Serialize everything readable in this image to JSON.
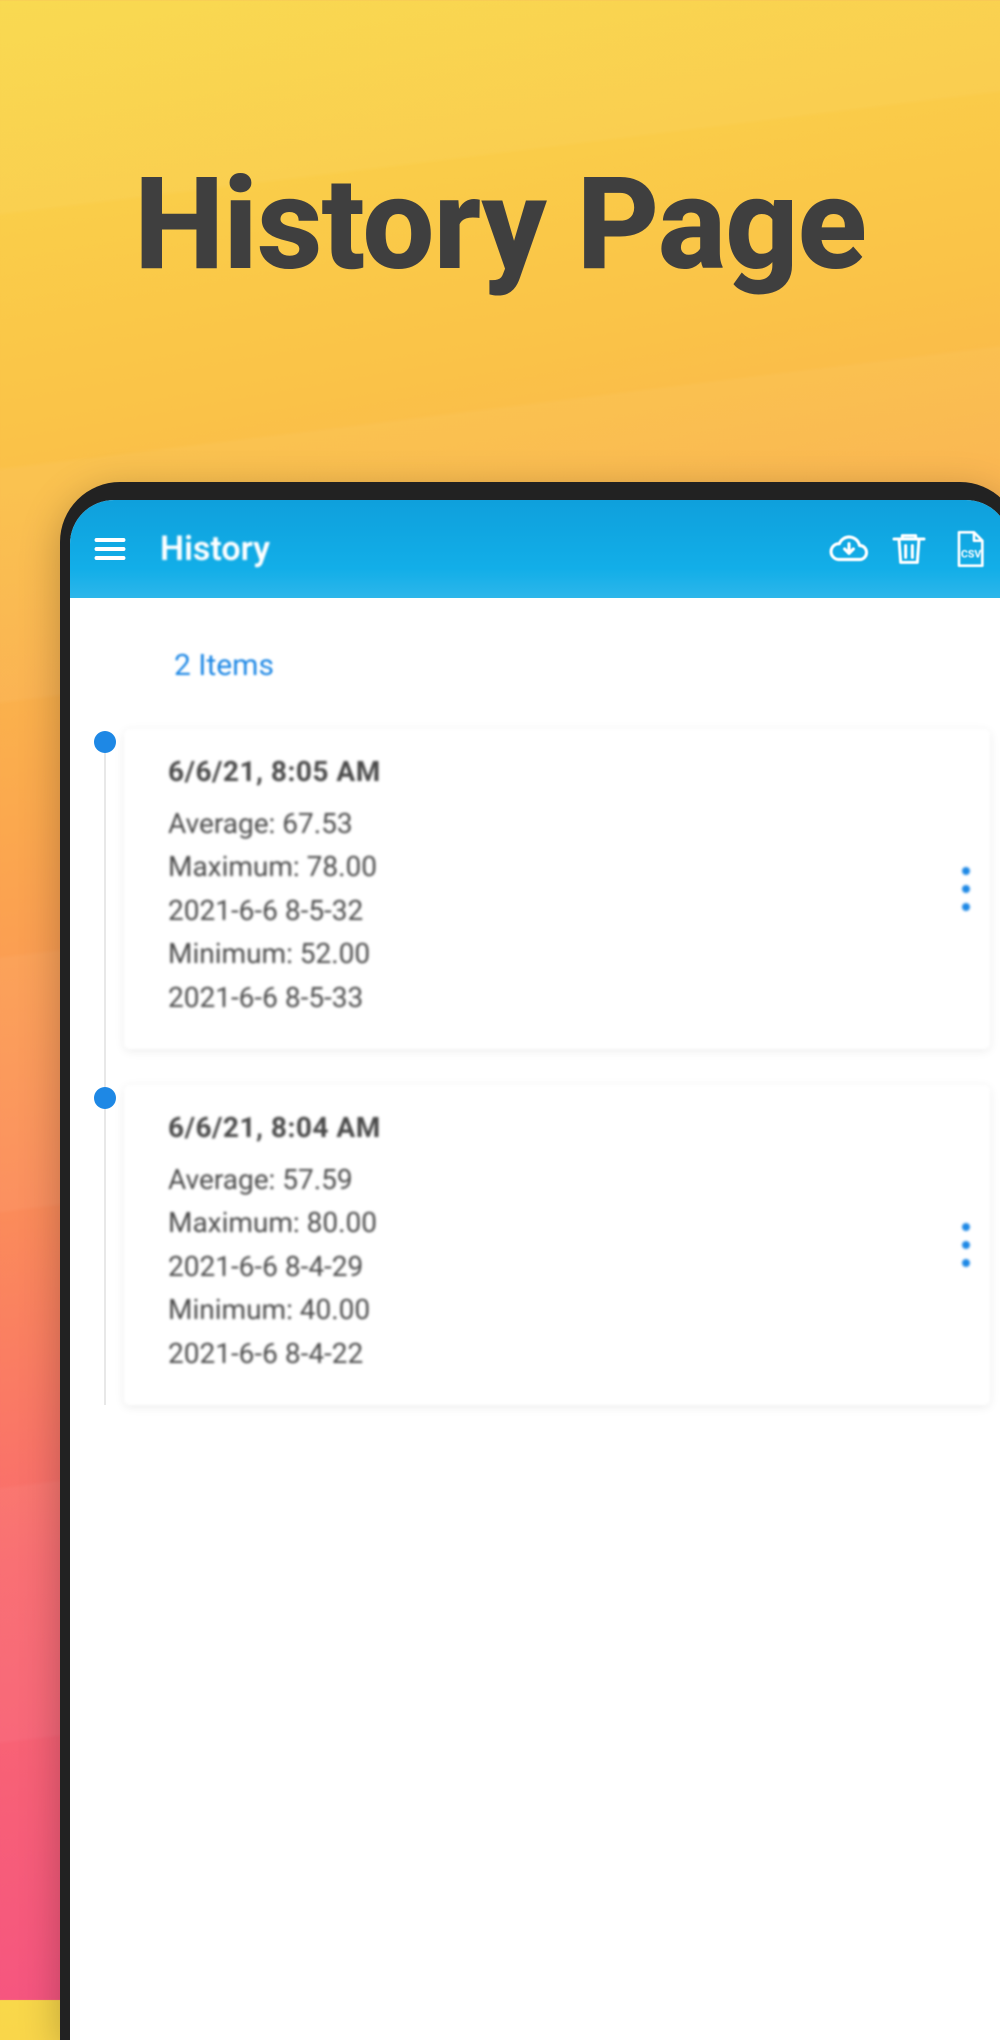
{
  "promo": {
    "title": "History Page"
  },
  "appbar": {
    "title": "History",
    "icons": {
      "menu": "menu-icon",
      "download": "cloud-download-icon",
      "delete": "trash-icon",
      "csv": "csv-export-icon"
    }
  },
  "content": {
    "count_label": "2 Items",
    "entries": [
      {
        "timestamp": "6/6/21, 8:05 AM",
        "lines": [
          "Average: 67.53",
          "Maximum: 78.00",
          "2021-6-6 8-5-32",
          "Minimum: 52.00",
          "2021-6-6 8-5-33"
        ]
      },
      {
        "timestamp": "6/6/21, 8:04 AM",
        "lines": [
          "Average: 57.59",
          "Maximum: 80.00",
          "2021-6-6 8-4-29",
          "Minimum: 40.00",
          "2021-6-6 8-4-22"
        ]
      }
    ]
  }
}
